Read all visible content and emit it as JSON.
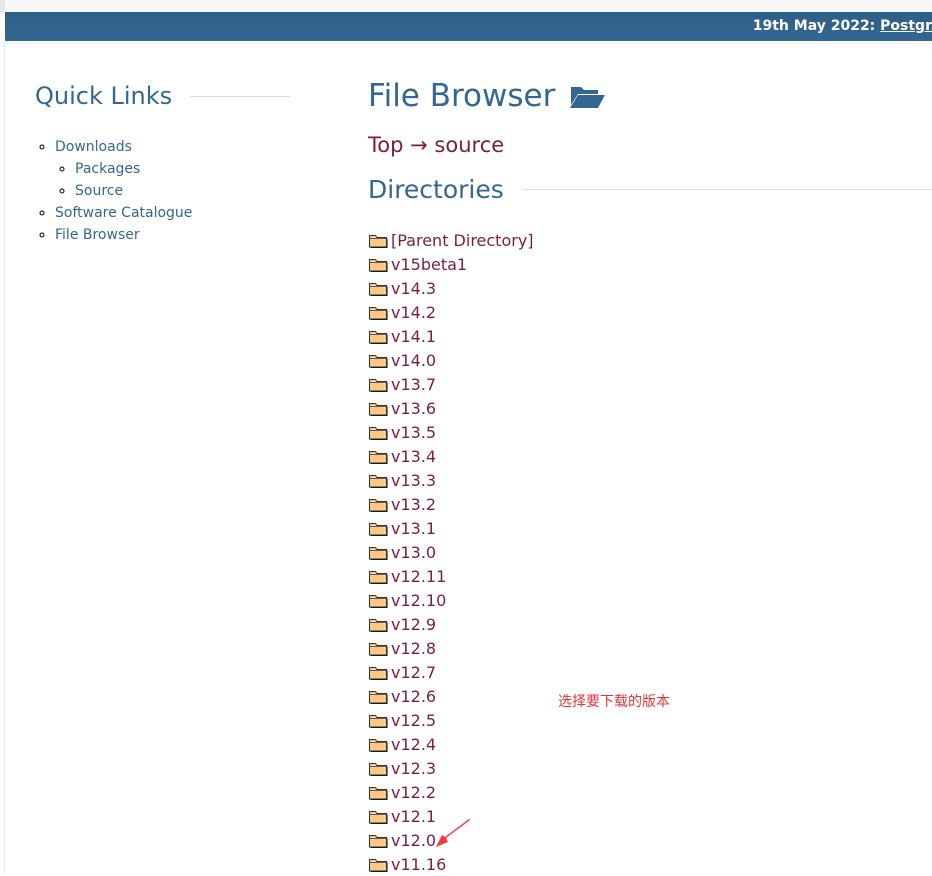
{
  "banner": {
    "date": "19th May 2022: ",
    "link": "Postgr"
  },
  "sidebar": {
    "title": "Quick Links",
    "items": [
      {
        "label": "Downloads",
        "children": [
          {
            "label": "Packages"
          },
          {
            "label": "Source"
          }
        ]
      },
      {
        "label": "Software Catalogue"
      },
      {
        "label": "File Browser"
      }
    ]
  },
  "main": {
    "title": "File Browser",
    "title_icon": "folder-open-icon",
    "breadcrumb": {
      "top": "Top",
      "arrow": "→",
      "current": "source"
    },
    "directories_heading": "Directories",
    "directories": [
      "[Parent Directory]",
      "v15beta1",
      "v14.3",
      "v14.2",
      "v14.1",
      "v14.0",
      "v13.7",
      "v13.6",
      "v13.5",
      "v13.4",
      "v13.3",
      "v13.2",
      "v13.1",
      "v13.0",
      "v12.11",
      "v12.10",
      "v12.9",
      "v12.8",
      "v12.7",
      "v12.6",
      "v12.5",
      "v12.4",
      "v12.3",
      "v12.2",
      "v12.1",
      "v12.0",
      "v11.16"
    ]
  },
  "annotation": {
    "text": "选择要下载的版本",
    "color": "#e8333a"
  },
  "colors": {
    "banner": "#336791",
    "link": "#7a1e3c",
    "heading": "#336791"
  }
}
